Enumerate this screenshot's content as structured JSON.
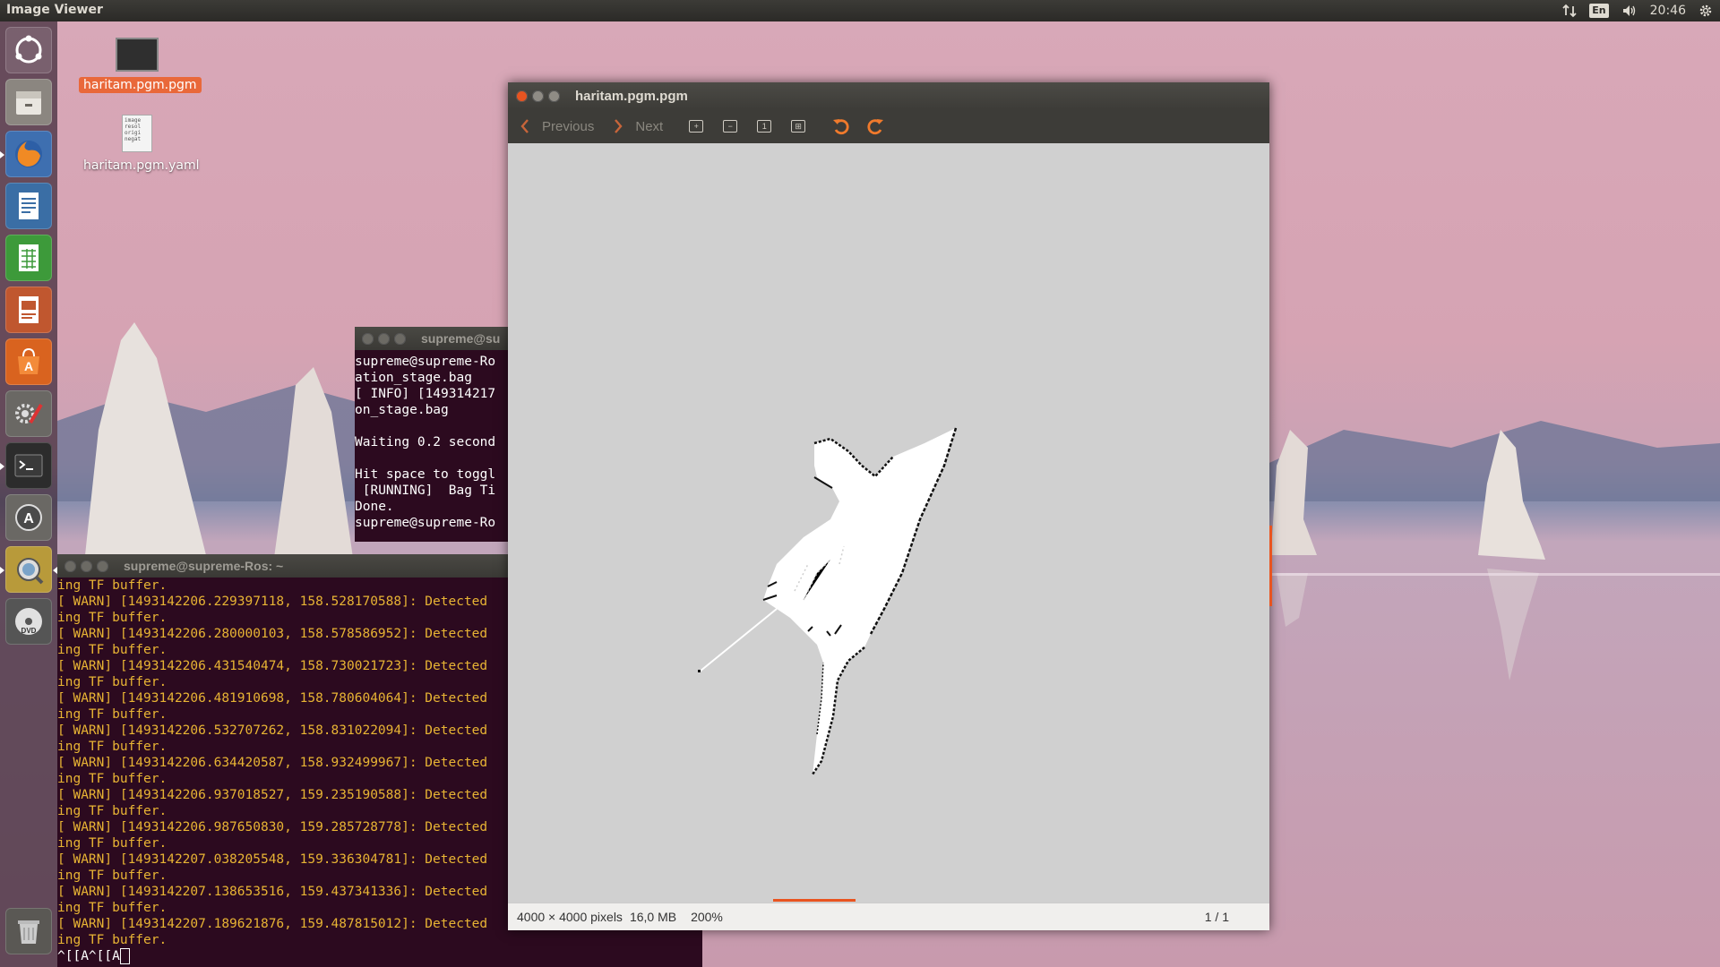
{
  "top_panel": {
    "app_title": "Image Viewer",
    "lang": "En",
    "time": "20:46",
    "icons": [
      "network-icon",
      "keyboard-lang-icon",
      "volume-icon",
      "clock",
      "gear-icon"
    ]
  },
  "launcher": {
    "items": [
      {
        "name": "ubuntu-dash-icon"
      },
      {
        "name": "files-icon"
      },
      {
        "name": "firefox-icon"
      },
      {
        "name": "writer-icon"
      },
      {
        "name": "calc-icon"
      },
      {
        "name": "impress-icon"
      },
      {
        "name": "software-center-icon"
      },
      {
        "name": "system-settings-icon"
      },
      {
        "name": "terminal-icon"
      },
      {
        "name": "software-updater-icon"
      },
      {
        "name": "image-viewer-icon"
      },
      {
        "name": "dvd-icon"
      },
      {
        "name": "trash-icon"
      }
    ]
  },
  "desktop": {
    "icons": [
      {
        "label": "haritam.pgm.pgm",
        "selected": true
      },
      {
        "label": "haritam.pgm.yaml",
        "preview_text": "image resol origi negat"
      }
    ]
  },
  "terminal_back": {
    "title": "supreme@su",
    "lines": [
      "supreme@supreme-Ro",
      "ation_stage.bag",
      "[ INFO] [149314217",
      "on_stage.bag",
      "",
      "Waiting 0.2 second",
      "",
      "Hit space to toggl",
      " [RUNNING]  Bag Ti",
      "Done.",
      "supreme@supreme-Ro"
    ]
  },
  "terminal_front": {
    "title": "supreme@supreme-Ros: ~",
    "lines": [
      "ing TF buffer.",
      "[ WARN] [1493142206.229397118, 158.528170588]: Detected",
      "ing TF buffer.",
      "[ WARN] [1493142206.280000103, 158.578586952]: Detected",
      "ing TF buffer.",
      "[ WARN] [1493142206.431540474, 158.730021723]: Detected",
      "ing TF buffer.",
      "[ WARN] [1493142206.481910698, 158.780604064]: Detected",
      "ing TF buffer.",
      "[ WARN] [1493142206.532707262, 158.831022094]: Detected",
      "ing TF buffer.",
      "[ WARN] [1493142206.634420587, 158.932499967]: Detected",
      "ing TF buffer.",
      "[ WARN] [1493142206.937018527, 159.235190588]: Detected",
      "ing TF buffer.",
      "[ WARN] [1493142206.987650830, 159.285728778]: Detected",
      "ing TF buffer.",
      "[ WARN] [1493142207.038205548, 159.336304781]: Detected",
      "ing TF buffer.",
      "[ WARN] [1493142207.138653516, 159.437341336]: Detected",
      "ing TF buffer.",
      "[ WARN] [1493142207.189621876, 159.487815012]: Detected",
      "ing TF buffer."
    ],
    "prompt": "^[[A^[[A"
  },
  "viewer": {
    "title": "haritam.pgm.pgm",
    "toolbar": {
      "previous_label": "Previous",
      "next_label": "Next"
    },
    "status": {
      "dimensions": "4000 × 4000 pixels",
      "size": "16,0 MB",
      "zoom": "200%",
      "page": "1 / 1"
    }
  }
}
